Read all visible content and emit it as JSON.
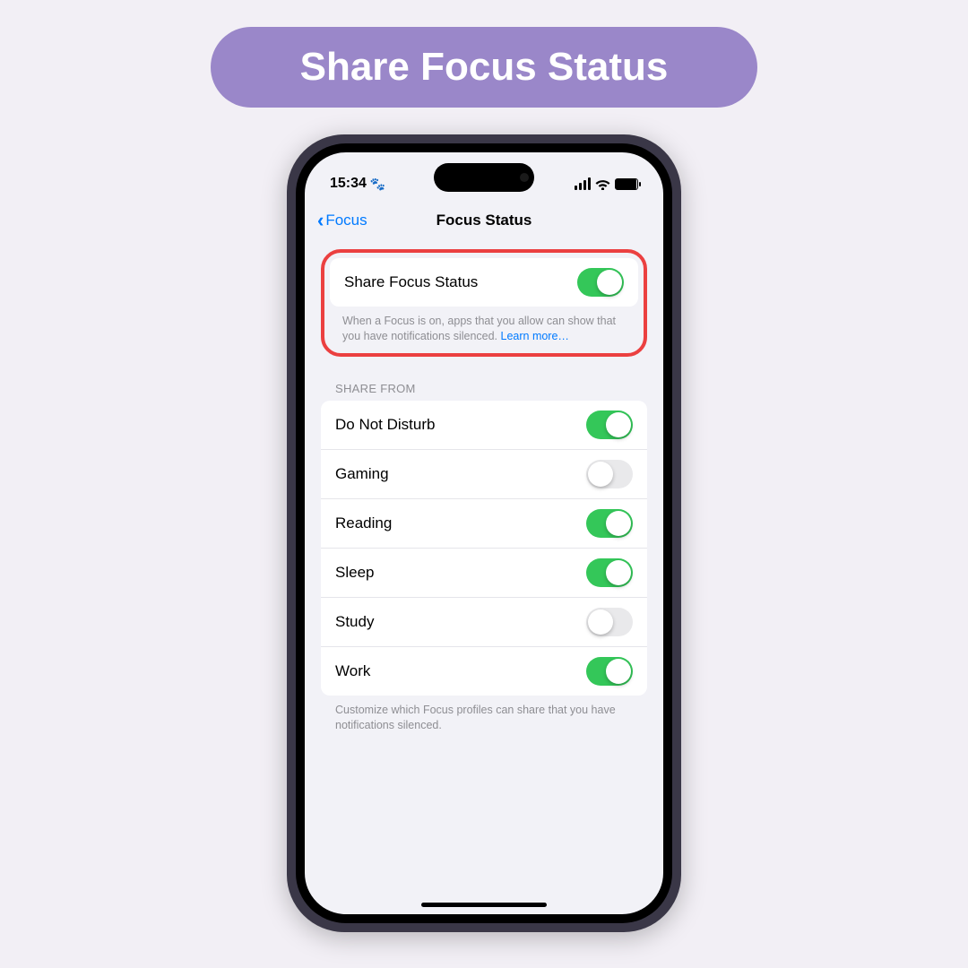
{
  "banner": {
    "title": "Share Focus Status"
  },
  "status": {
    "time": "15:34",
    "paw": "🐾",
    "battery_percent": 95
  },
  "nav": {
    "back_label": "Focus",
    "title": "Focus Status"
  },
  "main_toggle": {
    "label": "Share Focus Status",
    "on": true,
    "description": "When a Focus is on, apps that you allow can show that you have notifications silenced. ",
    "learn_more": "Learn more…"
  },
  "share_from": {
    "header": "SHARE FROM",
    "items": [
      {
        "label": "Do Not Disturb",
        "on": true
      },
      {
        "label": "Gaming",
        "on": false
      },
      {
        "label": "Reading",
        "on": true
      },
      {
        "label": "Sleep",
        "on": true
      },
      {
        "label": "Study",
        "on": false
      },
      {
        "label": "Work",
        "on": true
      }
    ],
    "footer": "Customize which Focus profiles can share that you have notifications silenced."
  }
}
